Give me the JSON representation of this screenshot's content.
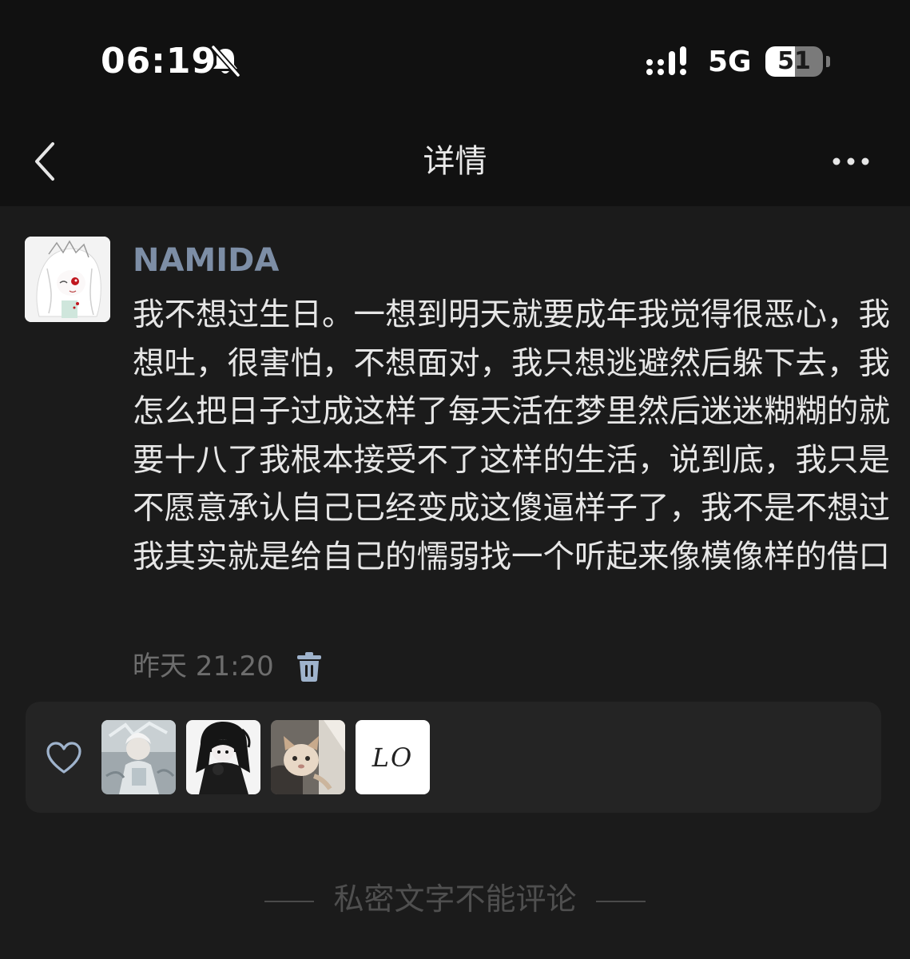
{
  "status_bar": {
    "time": "06:19",
    "network": "5G",
    "battery_level": "51",
    "battery_fraction": 0.51
  },
  "nav": {
    "title": "详情",
    "back_icon": "chevron-left-icon",
    "more_icon": "more-dots-icon"
  },
  "post": {
    "username": "NAMIDA",
    "text": "我不想过生日。一想到明天就要成年我觉得很恶心，我想吐，很害怕，不想面对，我只想逃避然后躲下去，我怎么把日子过成这样了每天活在梦里然后迷迷糊糊的就要十八了我根本接受不了这样的生活，说到底，我只是不愿意承认自己已经变成这傻逼样子了，我不是不想过我其实就是给自己的懦弱找一个听起来像模像样的借口",
    "timestamp": "昨天 21:20",
    "delete_icon": "trash-icon"
  },
  "likes": {
    "like_icon": "heart-outline-icon",
    "likers": [
      {
        "kind": "avatar-image"
      },
      {
        "kind": "avatar-image"
      },
      {
        "kind": "avatar-image"
      },
      {
        "kind": "text-avatar",
        "text": "LO"
      }
    ]
  },
  "footer": {
    "note": "私密文字不能评论"
  },
  "colors": {
    "background": "#1b1b1b",
    "top_bar": "#111111",
    "username": "#7d8ea6",
    "body_text": "#e6e6e6",
    "muted_text": "#6d6d6d",
    "panel": "#242424",
    "delete_icon": "#9fb3cc"
  }
}
